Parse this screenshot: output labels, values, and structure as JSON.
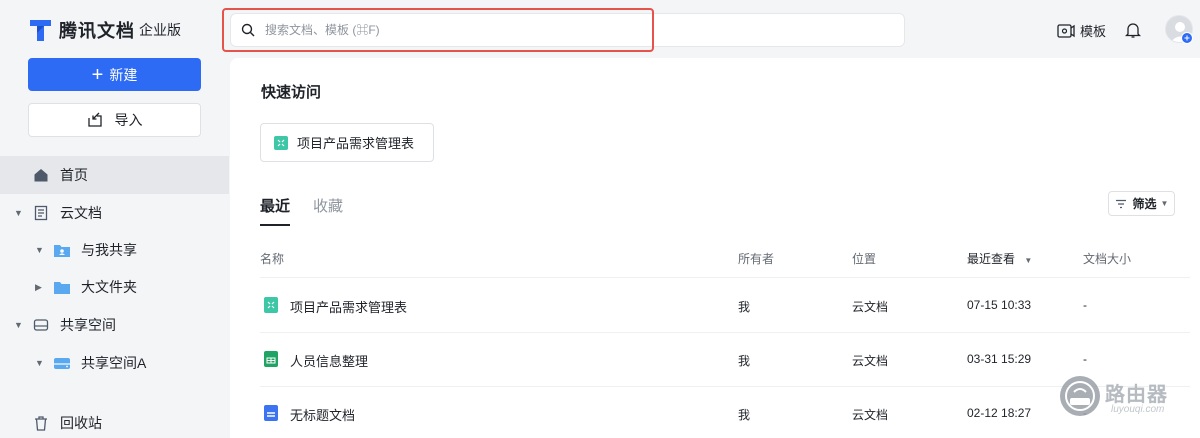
{
  "app": {
    "title": "腾讯文档",
    "edition": "企业版"
  },
  "sidebar": {
    "new_label": "新建",
    "import_label": "导入",
    "items": [
      {
        "label": "首页",
        "icon": "home-icon"
      },
      {
        "label": "云文档",
        "icon": "document-icon"
      },
      {
        "label": "与我共享",
        "icon": "shared-folder-icon"
      },
      {
        "label": "大文件夹",
        "icon": "folder-icon"
      },
      {
        "label": "共享空间",
        "icon": "drive-icon"
      },
      {
        "label": "共享空间A",
        "icon": "space-icon"
      },
      {
        "label": "回收站",
        "icon": "trash-icon"
      }
    ]
  },
  "header": {
    "search_placeholder": "搜索文档、模板 (⌘F)",
    "template_label": "模板"
  },
  "main": {
    "quick_access_title": "快速访问",
    "quick_access_items": [
      {
        "label": "项目产品需求管理表",
        "icon": "sheet-icon"
      }
    ],
    "tabs": [
      {
        "label": "最近",
        "active": true
      },
      {
        "label": "收藏",
        "active": false
      }
    ],
    "filter_label": "筛选",
    "columns": {
      "name": "名称",
      "owner": "所有者",
      "location": "位置",
      "last_viewed": "最近查看",
      "size": "文档大小"
    },
    "rows": [
      {
        "name": "项目产品需求管理表",
        "owner": "我",
        "location": "云文档",
        "time": "07-15 10:33",
        "size": "-",
        "icon": "smartsheet-icon"
      },
      {
        "name": "人员信息整理",
        "owner": "我",
        "location": "云文档",
        "time": "03-31 15:29",
        "size": "-",
        "icon": "spreadsheet-icon"
      },
      {
        "name": "无标题文档",
        "owner": "我",
        "location": "云文档",
        "time": "02-12 18:27",
        "size": "-",
        "icon": "doc-icon"
      }
    ]
  },
  "watermark": {
    "text": "路由器",
    "sub": "luyouqi.com"
  },
  "colors": {
    "primary": "#2d6bf4",
    "highlight_border": "#e5534b",
    "sheet_green": "#3ec7a6",
    "excel_green": "#21a366",
    "doc_blue": "#3b73f1"
  }
}
